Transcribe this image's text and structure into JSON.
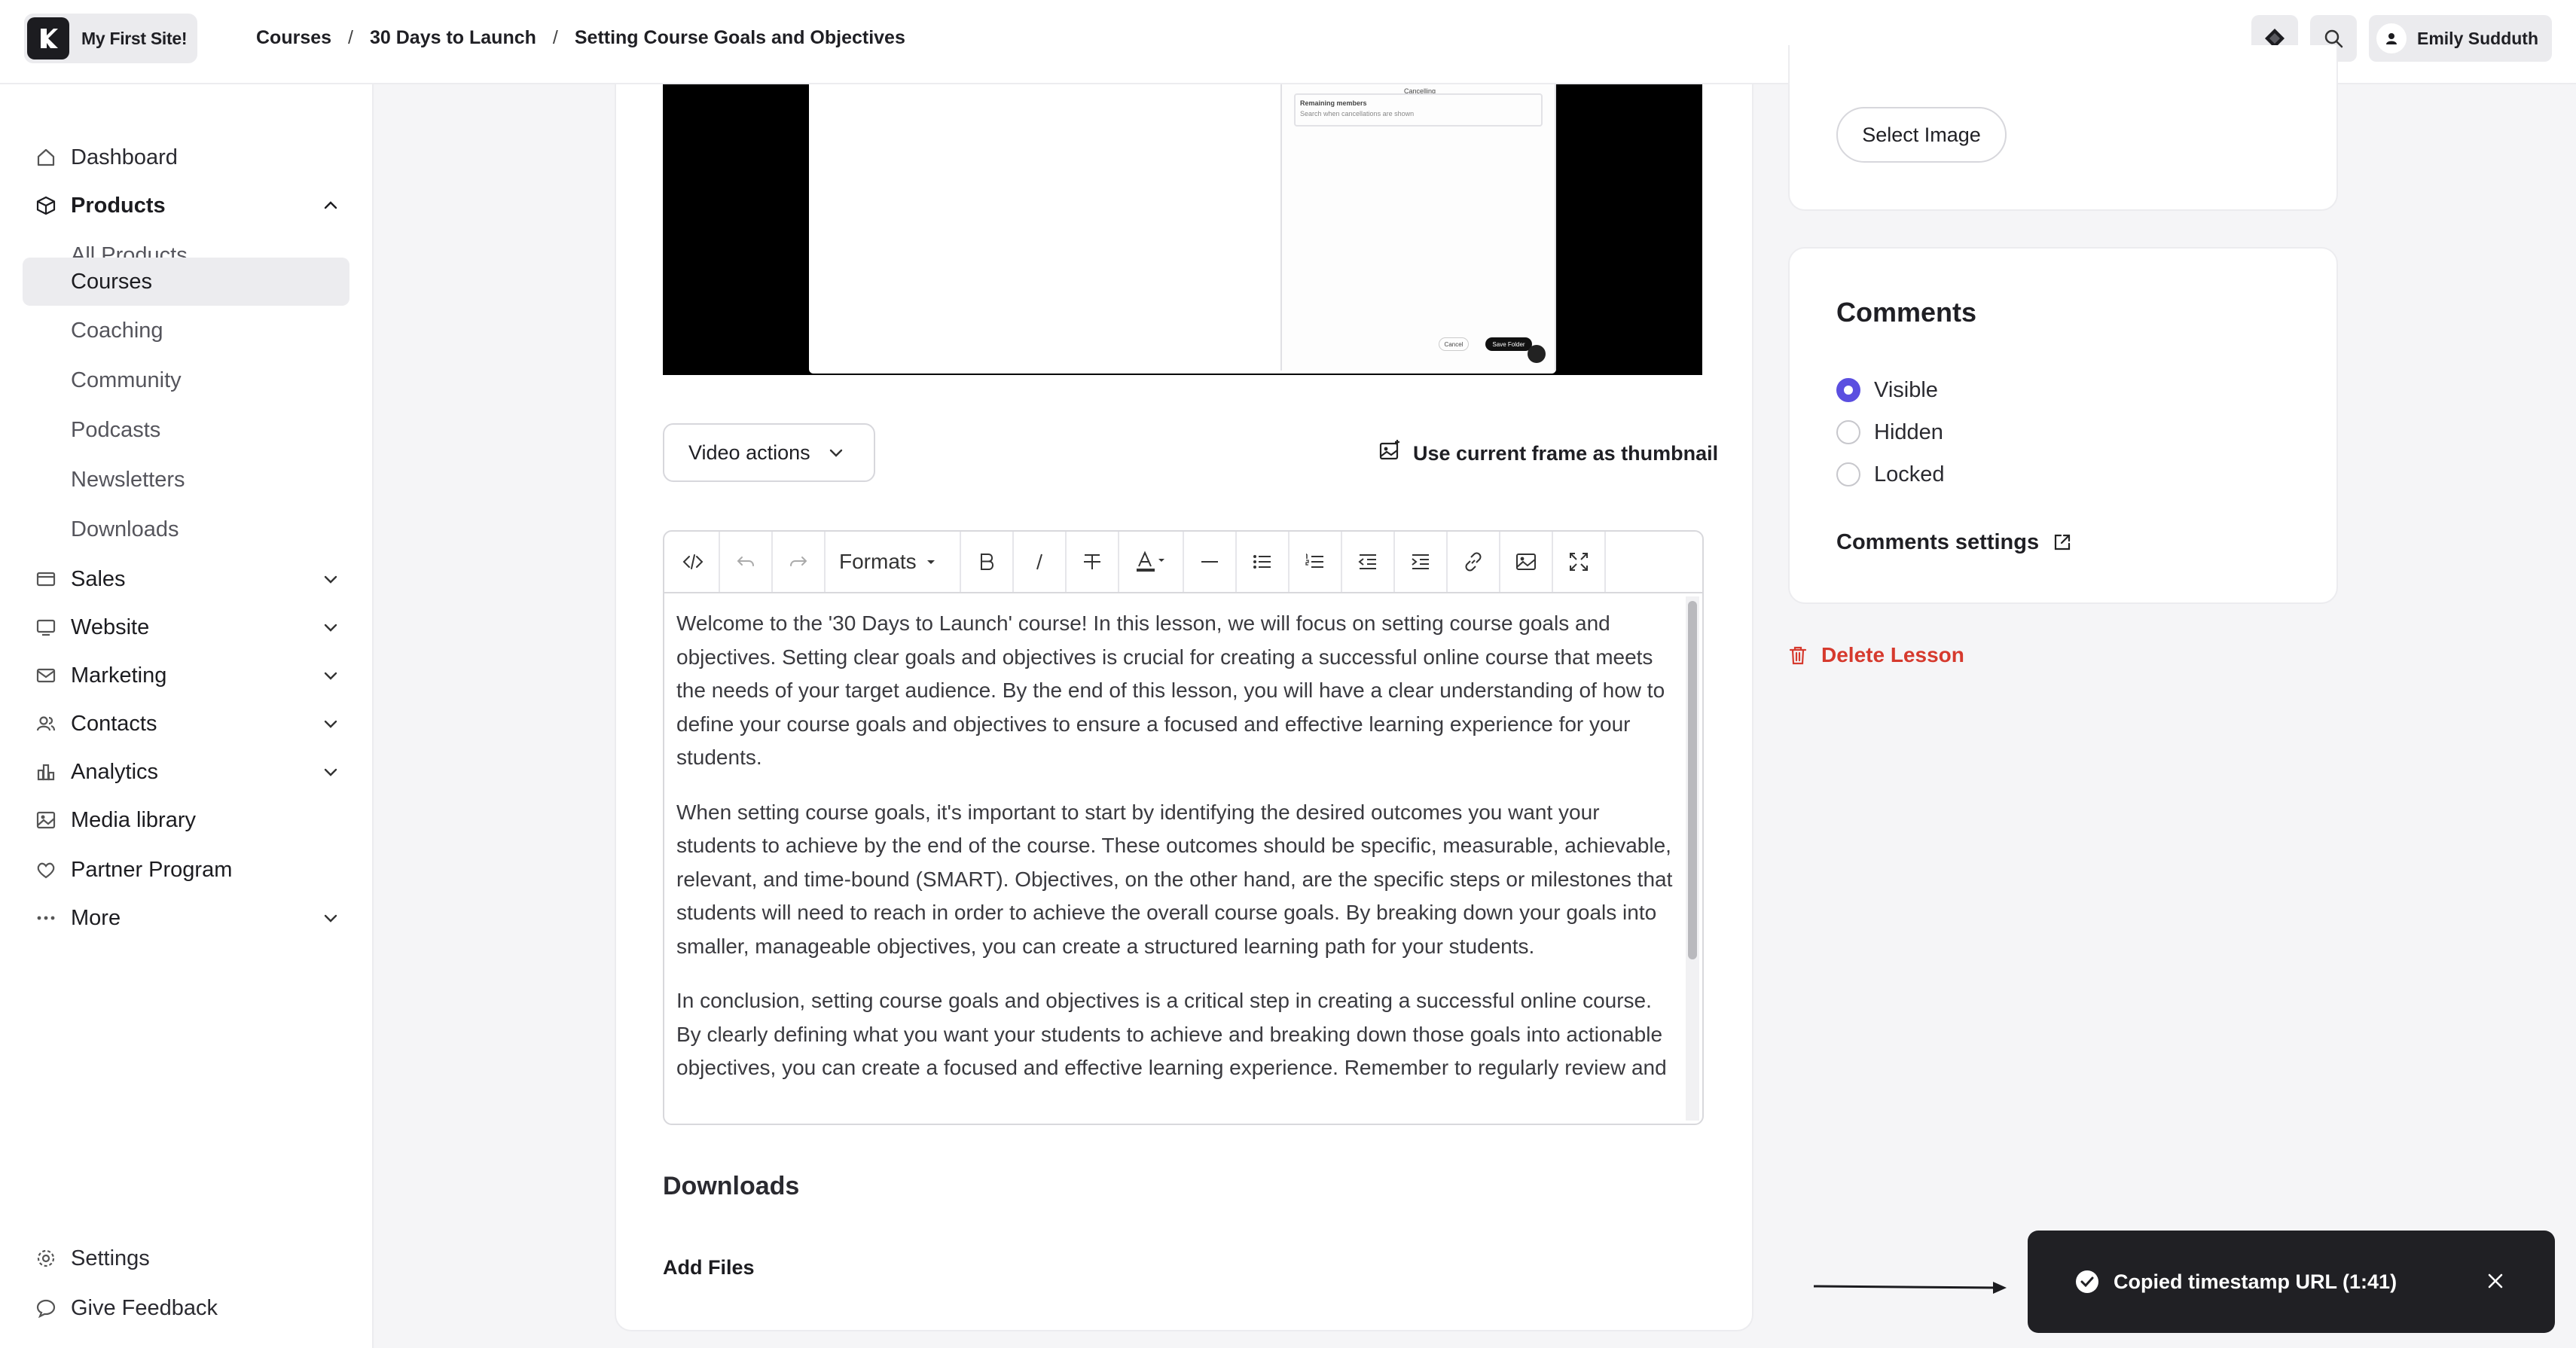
{
  "site": {
    "name": "My First Site!",
    "logo_letter": "K"
  },
  "breadcrumb": [
    "Courses",
    "30 Days to Launch",
    "Setting Course Goals and Objectives"
  ],
  "user": {
    "name": "Emily Sudduth"
  },
  "sidebar": {
    "items": [
      {
        "label": "Dashboard",
        "icon": "home-icon"
      },
      {
        "label": "Products",
        "icon": "box-icon",
        "expanded": true
      },
      {
        "label": "Sales",
        "icon": "credit-card-icon"
      },
      {
        "label": "Website",
        "icon": "monitor-icon"
      },
      {
        "label": "Marketing",
        "icon": "mail-icon"
      },
      {
        "label": "Contacts",
        "icon": "users-icon"
      },
      {
        "label": "Analytics",
        "icon": "bar-chart-icon"
      },
      {
        "label": "Media library",
        "icon": "image-icon"
      },
      {
        "label": "Partner Program",
        "icon": "partner-icon"
      },
      {
        "label": "More",
        "icon": "more-icon"
      }
    ],
    "sub_items": [
      "All Products",
      "Courses",
      "Coaching",
      "Community",
      "Podcasts",
      "Newsletters",
      "Downloads"
    ],
    "active_sub": "Courses",
    "footer": [
      {
        "label": "Settings",
        "icon": "gear-icon"
      },
      {
        "label": "Give Feedback",
        "icon": "chat-icon"
      }
    ]
  },
  "video": {
    "modal_title": "Cancelling",
    "modal_row": "Remaining members",
    "modal_sub": "Search when cancellations are shown",
    "cancel": "Cancel",
    "save": "Save Folder"
  },
  "video_actions": {
    "label": "Video actions"
  },
  "thumbnail_link": {
    "label": "Use current frame as thumbnail"
  },
  "editor": {
    "formats_label": "Formats",
    "paragraphs": [
      "Welcome to the '30 Days to Launch' course! In this lesson, we will focus on setting course goals and objectives. Setting clear goals and objectives is crucial for creating a successful online course that meets the needs of your target audience. By the end of this lesson, you will have a clear understanding of how to define your course goals and objectives to ensure a focused and effective learning experience for your students.",
      "When setting course goals, it's important to start by identifying the desired outcomes you want your students to achieve by the end of the course. These outcomes should be specific, measurable, achievable, relevant, and time-bound (SMART). Objectives, on the other hand, are the specific steps or milestones that students will need to reach in order to achieve the overall course goals. By breaking down your goals into smaller, manageable objectives, you can create a structured learning path for your students.",
      "In conclusion, setting course goals and objectives is a critical step in creating a successful online course. By clearly defining what you want your students to achieve and breaking down those goals into actionable objectives, you can create a focused and effective learning experience. Remember to regularly review and"
    ]
  },
  "downloads": {
    "title": "Downloads",
    "add_files": "Add Files"
  },
  "image_card": {
    "select_image": "Select Image"
  },
  "comments": {
    "title": "Comments",
    "options": [
      "Visible",
      "Hidden",
      "Locked"
    ],
    "selected": "Visible",
    "settings_label": "Comments settings"
  },
  "delete_lesson": "Delete Lesson",
  "toast": {
    "message": "Copied timestamp URL (1:41)"
  },
  "colors": {
    "accent": "#5b4fe0",
    "danger": "#d63a2e",
    "toast_bg": "#202024"
  }
}
